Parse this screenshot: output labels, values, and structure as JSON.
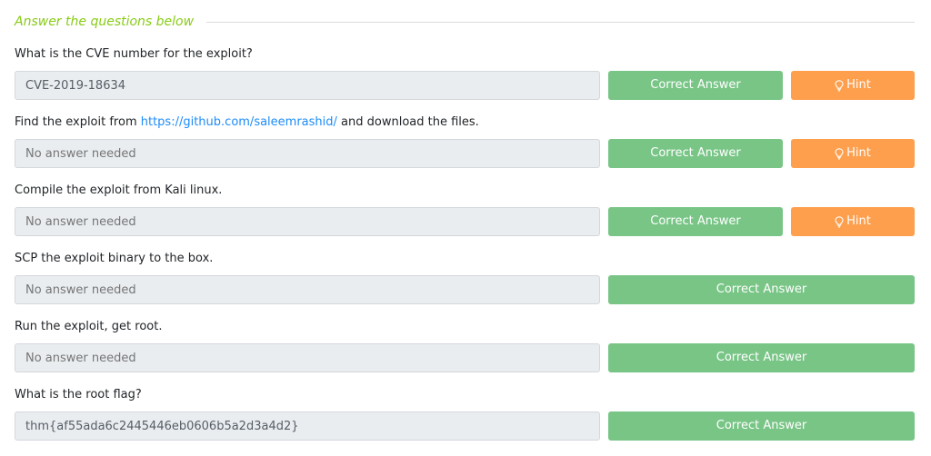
{
  "section": {
    "title": "Answer the questions below"
  },
  "labels": {
    "correct_answer": "Correct Answer",
    "hint": "Hint"
  },
  "questions": [
    {
      "text": "What is the CVE number for the exploit?",
      "answer": "CVE-2019-18634",
      "has_hint": true
    },
    {
      "text_before": "Find the exploit from ",
      "link": "https://github.com/saleemrashid/",
      "text_after": " and download the files.",
      "placeholder": "No answer needed",
      "has_hint": true
    },
    {
      "text": "Compile the exploit from Kali linux.",
      "placeholder": "No answer needed",
      "has_hint": true
    },
    {
      "text": "SCP the exploit binary to the box.",
      "placeholder": "No answer needed",
      "has_hint": false
    },
    {
      "text": "Run the exploit, get root.",
      "placeholder": "No answer needed",
      "has_hint": false
    },
    {
      "text": "What is the root flag?",
      "answer": "thm{af55ada6c2445446eb0606b5a2d3a4d2}",
      "has_hint": false
    }
  ],
  "colors": {
    "accent": "#88cc14",
    "correct": "#78c586",
    "hint": "#fd9f4c",
    "link": "#1d8cf8"
  },
  "icons": {
    "hint": "lightbulb-icon"
  }
}
